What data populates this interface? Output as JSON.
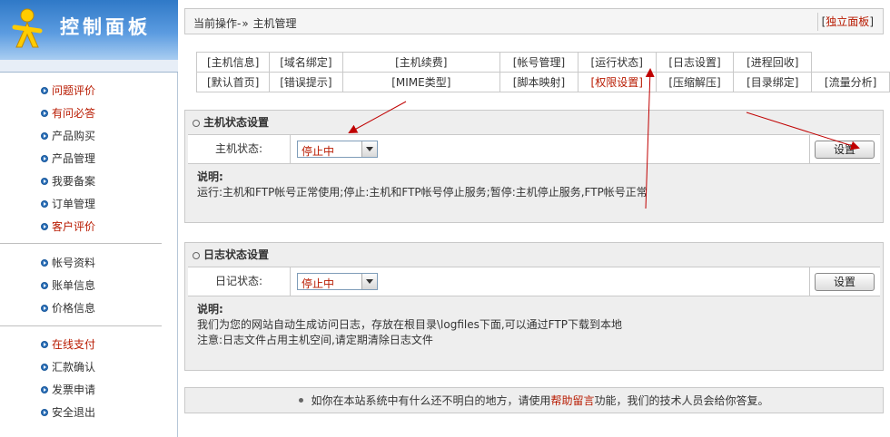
{
  "logo": {
    "title": "控制面板",
    "reflection": "控制面板"
  },
  "sidebar": {
    "groups": [
      [
        {
          "label": "问题评价",
          "highlight": true
        },
        {
          "label": "有问必答",
          "highlight": true
        },
        {
          "label": "产品购买",
          "highlight": false
        },
        {
          "label": "产品管理",
          "highlight": false
        },
        {
          "label": "我要备案",
          "highlight": false
        },
        {
          "label": "订单管理",
          "highlight": false
        },
        {
          "label": "客户评价",
          "highlight": true
        }
      ],
      [
        {
          "label": "帐号资料",
          "highlight": false
        },
        {
          "label": "账单信息",
          "highlight": false
        },
        {
          "label": "价格信息",
          "highlight": false
        }
      ],
      [
        {
          "label": "在线支付",
          "highlight": true
        },
        {
          "label": "汇款确认",
          "highlight": false
        },
        {
          "label": "发票申请",
          "highlight": false
        },
        {
          "label": "安全退出",
          "highlight": false
        }
      ]
    ]
  },
  "topbar": {
    "current_label": "当前操作-",
    "separator": "»",
    "current_page": "主机管理",
    "bracket_open": "[",
    "independent_panel": "独立面板",
    "bracket_close": "]"
  },
  "nav": {
    "row1": [
      {
        "label": "[主机信息]",
        "highlight": false
      },
      {
        "label": "[域名绑定]",
        "highlight": false
      },
      {
        "label": "[主机续费]",
        "highlight": false
      },
      {
        "label": "[帐号管理]",
        "highlight": false
      },
      {
        "label": "[运行状态]",
        "highlight": false
      },
      {
        "label": "[日志设置]",
        "highlight": false
      },
      {
        "label": "[进程回收]",
        "highlight": false
      }
    ],
    "row2": [
      {
        "label": "[默认首页]",
        "highlight": false
      },
      {
        "label": "[错误提示]",
        "highlight": false
      },
      {
        "label": "[MIME类型]",
        "highlight": false
      },
      {
        "label": "[脚本映射]",
        "highlight": false
      },
      {
        "label": "[权限设置]",
        "highlight": true
      },
      {
        "label": "[压缩解压]",
        "highlight": false
      },
      {
        "label": "[目录绑定]",
        "highlight": false
      },
      {
        "label": "[流量分析]",
        "highlight": false
      }
    ]
  },
  "host_panel": {
    "title": "主机状态设置",
    "field_label": "主机状态:",
    "select_value": "停止中",
    "button": "设置",
    "note_title": "说明:",
    "note_lines": [
      "运行:主机和FTP帐号正常使用;停止:主机和FTP帐号停止服务;暂停:主机停止服务,FTP帐号正常"
    ]
  },
  "log_panel": {
    "title": "日志状态设置",
    "field_label": "日记状态:",
    "select_value": "停止中",
    "button": "设置",
    "note_title": "说明:",
    "note_lines": [
      "我们为您的网站自动生成访问日志，存放在根目录\\logfiles下面,可以通过FTP下载到本地",
      "注意:日志文件占用主机空间,请定期清除日志文件"
    ]
  },
  "footer": {
    "before": "如你在本站系统中有什么还不明白的地方，请使用",
    "link": "帮助留言",
    "after": "功能，我们的技术人员会给你答复。"
  },
  "colors": {
    "highlight_red": "#b81a00",
    "bullet_blue": "#2a6fb8",
    "panel_gray": "#eeeeee",
    "annotation_arrow": "#c00000"
  }
}
